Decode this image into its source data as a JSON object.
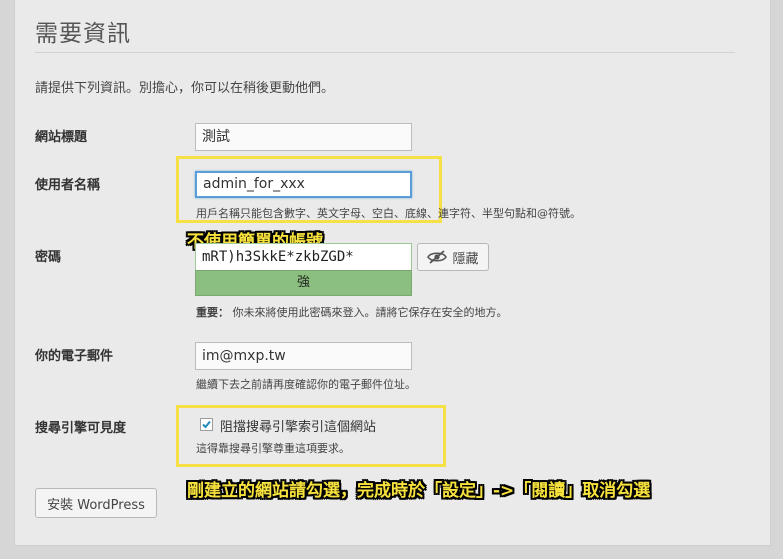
{
  "page": {
    "title": "需要資訊",
    "intro": "請提供下列資訊。別擔心，你可以在稍後更動他們。"
  },
  "fields": {
    "site_title": {
      "label": "網站標題",
      "value": "測試"
    },
    "username": {
      "label": "使用者名稱",
      "value": "admin_for_xxx",
      "hint": "用戶名稱只能包含數字、英文字母、空白、底線、連字符、半型句點和@符號。"
    },
    "password": {
      "label": "密碼",
      "value": "mRT)h3SkkE*zkbZGD*",
      "strength": "強",
      "hide_button": "隱藏",
      "note_bold": "重要：",
      "note": " 你未來將使用此密碼來登入。請將它保存在安全的地方。"
    },
    "email": {
      "label": "你的電子郵件",
      "value": "im@mxp.tw",
      "hint": "繼續下去之前請再度確認你的電子郵件位址。"
    },
    "visibility": {
      "label": "搜尋引擎可見度",
      "checkbox_label": "阻擋搜尋引擎索引這個網站",
      "checked": true,
      "hint": "這得靠搜尋引擎尊重這項要求。"
    }
  },
  "install_button": "安裝 WordPress",
  "annotations": {
    "username_note": "不使用簡單的帳號",
    "visibility_note": "剛建立的網站請勾選，完成時於「設定」->「閱讀」取消勾選"
  },
  "colors": {
    "highlight": "#f5e046",
    "strength_strong": "#8bbf7f",
    "focus": "#5b9dd9"
  }
}
